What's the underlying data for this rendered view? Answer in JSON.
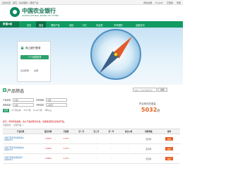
{
  "topbar": {
    "crumbs": "您的位置：首页 › 投资理财 › 理财产品",
    "links": [
      "网站地图",
      "English",
      "无障碍",
      "繁體"
    ]
  },
  "logo": {
    "cn": "中国农业银行",
    "en": "AGRICULTURAL BANK OF CHINA"
  },
  "nav": {
    "brand": "财富e站",
    "items": [
      "首页",
      "基金",
      "理财产品",
      "保险",
      "外汇",
      "贵金属",
      "专项理财",
      "金融资讯"
    ],
    "active_index": 1
  },
  "login": {
    "title": "网上银行登录",
    "button": "个人网银登录",
    "links": [
      "证书登录",
      "注册"
    ]
  },
  "filter": {
    "heading": "产品筛选",
    "search_placeholder": "请输入产品名称或代码",
    "search_button": "搜索",
    "rows": [
      {
        "label": "产品类型",
        "select1": "全部",
        "label2": "风险等级",
        "select2": "全部"
      },
      {
        "label": "期限类型",
        "select1": "全部",
        "label2": "币种类型",
        "select2": "人民币"
      }
    ],
    "chips": [
      "全部",
      "3个月以内",
      "3-6个月",
      "6-12个月",
      "1年以上"
    ],
    "chip_active": 0
  },
  "summary": {
    "label": "符合条件的基金",
    "count": "5032",
    "unit": "只"
  },
  "hint": "提示：风险评估等级，请以产品说明书为准，请谨慎选择适合您的产品。",
  "hint2": "已选条件：  全部产品 ×",
  "table": {
    "headers": [
      "产品名称",
      "最近净值",
      "日涨跌",
      "近一月",
      "近三月",
      "近一年",
      "成立以来",
      "风险等级",
      "操作"
    ],
    "rows": [
      {
        "name": "农银汇理货币市场基金A",
        "code": "(660007)",
        "nav": "1.0000",
        "day": "1.37%",
        "m1": "-",
        "m3": "-",
        "y1": "-",
        "since": "-",
        "risk": "低风险",
        "action": "购买"
      },
      {
        "name": "农银汇理货币市场基金B",
        "code": "(660107)",
        "nav": "1.0000",
        "day": "1.37%",
        "m1": "-",
        "m3": "-",
        "y1": "-",
        "since": "-",
        "risk": "低风险",
        "action": "购买"
      },
      {
        "name": "农银汇理现金管理货币",
        "code": "(000653)",
        "nav": "1.0000",
        "day": "1.37%",
        "m1": "-",
        "m3": "-",
        "y1": "-",
        "since": "-",
        "risk": "低风险",
        "action": "购买"
      }
    ]
  },
  "colors": {
    "nav": "#129a63",
    "nav_dark": "#0d7a4f",
    "accent": "#e0651e",
    "link": "#2c76b8"
  }
}
